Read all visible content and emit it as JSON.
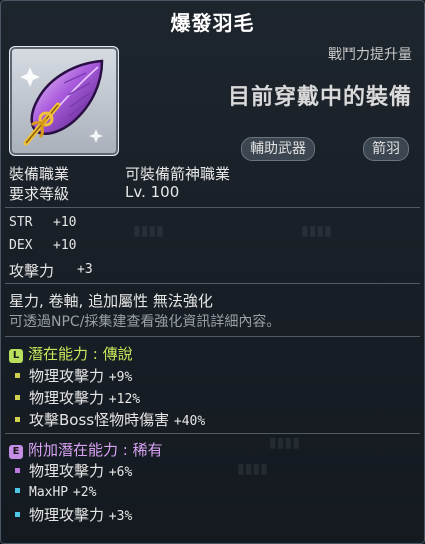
{
  "item": {
    "name": "爆發羽毛",
    "icon": "purple-feather-arrow-icon",
    "power_label": "戰鬥力提升量",
    "power_status": "目前穿戴中的裝備",
    "tags": [
      "輔助武器",
      "箭羽"
    ]
  },
  "requirements": {
    "job_label": "裝備職業",
    "job_value": "可裝備箭神職業",
    "level_label": "要求等級",
    "level_value": "Lv. 100"
  },
  "stats": [
    {
      "name": "STR",
      "value": "+10"
    },
    {
      "name": "DEX",
      "value": "+10"
    },
    {
      "name": "攻擊力",
      "value": "+3"
    }
  ],
  "flags": {
    "restrictions": "星力, 卷軸, 追加屬性 無法強化",
    "note": "可透過NPC/採集建查看強化資訊詳細內容。"
  },
  "potential": {
    "badge": "L",
    "header": "潛在能力 : 傳說",
    "color": "#b8e05c",
    "lines": [
      {
        "stat": "物理攻擊力",
        "value": "+9%"
      },
      {
        "stat": "物理攻擊力",
        "value": "+12%"
      },
      {
        "stat": "攻擊Boss怪物時傷害",
        "value": "+40%"
      }
    ]
  },
  "additional_potential": {
    "badge": "E",
    "header": "附加潛在能力 : 稀有",
    "color": "#c68ee6",
    "lines": [
      {
        "stat": "物理攻擊力",
        "value": "+6%"
      },
      {
        "stat": "MaxHP",
        "value": "+2%"
      },
      {
        "stat": "物理攻擊力",
        "value": "+3%"
      }
    ]
  }
}
